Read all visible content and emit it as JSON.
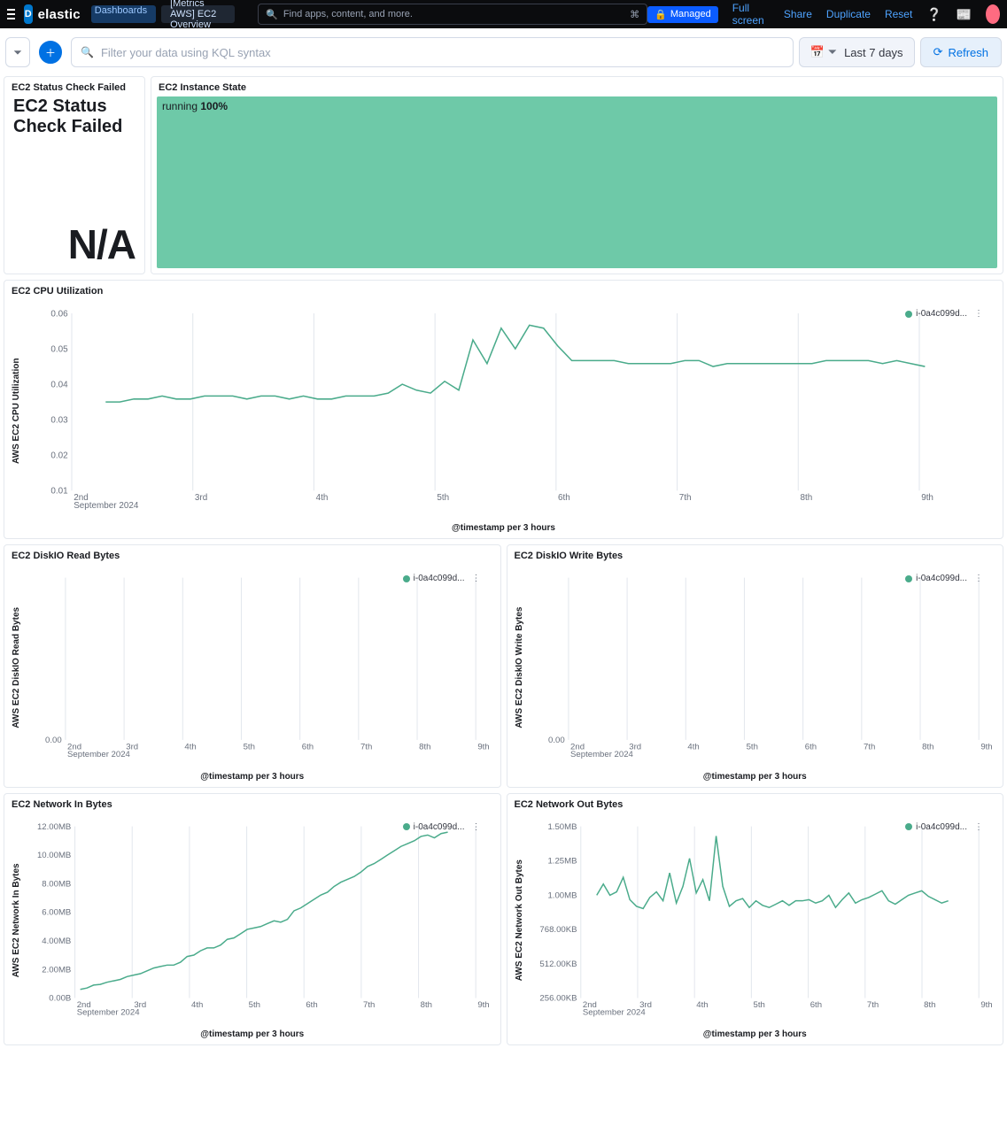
{
  "top": {
    "logo_text": "elastic",
    "logo_badge": "D",
    "breadcrumb_1": "Dashboards",
    "breadcrumb_2": "[Metrics AWS] EC2 Overview",
    "search_placeholder": "Find apps, content, and more.",
    "managed": "Managed",
    "links": [
      "Full screen",
      "Share",
      "Duplicate",
      "Reset"
    ]
  },
  "filter": {
    "placeholder": "Filter your data using KQL syntax",
    "time": "Last 7 days",
    "refresh": "Refresh"
  },
  "panels": {
    "status_fail": {
      "title": "EC2 Status Check Failed",
      "heading": "EC2 Status Check Failed",
      "value": "N/A"
    },
    "state": {
      "title": "EC2 Instance State",
      "label": "running",
      "pct": "100%"
    },
    "cpu": {
      "title": "EC2 CPU Utilization",
      "ylabel": "AWS EC2 CPU Utilization",
      "xlabel": "@timestamp per 3 hours"
    },
    "disk_r": {
      "title": "EC2 DiskIO Read Bytes",
      "ylabel": "AWS EC2 DiskIO Read Bytes",
      "xlabel": "@timestamp per 3 hours"
    },
    "disk_w": {
      "title": "EC2 DiskIO Write Bytes",
      "ylabel": "AWS EC2 DiskIO Write Bytes",
      "xlabel": "@timestamp per 3 hours"
    },
    "net_in": {
      "title": "EC2 Network In Bytes",
      "ylabel": "AWS EC2 Network In Bytes",
      "xlabel": "@timestamp per 3 hours"
    },
    "net_out": {
      "title": "EC2 Network Out Bytes",
      "ylabel": "AWS EC2 Network Out Bytes",
      "xlabel": "@timestamp per 3 hours"
    },
    "legend_series": "i-0a4c099d..."
  },
  "x_month": "September 2024",
  "chart_data": [
    {
      "id": "cpu",
      "type": "line",
      "title": "EC2 CPU Utilization",
      "xlabel": "@timestamp per 3 hours",
      "ylabel": "AWS EC2 CPU Utilization",
      "ylim": [
        0,
        0.06
      ],
      "yticks": [
        0.01,
        0.02,
        0.03,
        0.04,
        0.05,
        0.06
      ],
      "xticks": [
        "2nd",
        "3rd",
        "4th",
        "5th",
        "6th",
        "7th",
        "8th",
        "9th"
      ],
      "series": [
        {
          "name": "i-0a4c099d...",
          "x_start": 2.3,
          "x_step": 0.125,
          "values": [
            0.03,
            0.03,
            0.031,
            0.031,
            0.032,
            0.031,
            0.031,
            0.032,
            0.032,
            0.032,
            0.031,
            0.032,
            0.032,
            0.031,
            0.032,
            0.031,
            0.031,
            0.032,
            0.032,
            0.032,
            0.033,
            0.036,
            0.034,
            0.033,
            0.037,
            0.034,
            0.051,
            0.043,
            0.055,
            0.048,
            0.056,
            0.055,
            0.049,
            0.044,
            0.044,
            0.044,
            0.044,
            0.043,
            0.043,
            0.043,
            0.043,
            0.044,
            0.044,
            0.042,
            0.043,
            0.043,
            0.043,
            0.043,
            0.043,
            0.043,
            0.043,
            0.044,
            0.044,
            0.044,
            0.044,
            0.043,
            0.044,
            0.043,
            0.042
          ]
        }
      ]
    },
    {
      "id": "disk_r",
      "type": "line",
      "title": "EC2 DiskIO Read Bytes",
      "xlabel": "@timestamp per 3 hours",
      "ylabel": "AWS EC2 DiskIO Read Bytes",
      "yticks": [
        "0.00"
      ],
      "xticks": [
        "2nd",
        "3rd",
        "4th",
        "5th",
        "6th",
        "7th",
        "8th",
        "9th"
      ],
      "series": [
        {
          "name": "i-0a4c099d...",
          "values": []
        }
      ]
    },
    {
      "id": "disk_w",
      "type": "line",
      "title": "EC2 DiskIO Write Bytes",
      "xlabel": "@timestamp per 3 hours",
      "ylabel": "AWS EC2 DiskIO Write Bytes",
      "yticks": [
        "0.00"
      ],
      "xticks": [
        "2nd",
        "3rd",
        "4th",
        "5th",
        "6th",
        "7th",
        "8th",
        "9th"
      ],
      "series": [
        {
          "name": "i-0a4c099d...",
          "values": []
        }
      ]
    },
    {
      "id": "net_in",
      "type": "line",
      "title": "EC2 Network In Bytes",
      "xlabel": "@timestamp per 3 hours",
      "ylabel": "AWS EC2 Network In Bytes",
      "ylim_mb": [
        0,
        12
      ],
      "yticks": [
        "0.00B",
        "2.00MB",
        "4.00MB",
        "6.00MB",
        "8.00MB",
        "10.00MB",
        "12.00MB"
      ],
      "xticks": [
        "2nd",
        "3rd",
        "4th",
        "5th",
        "6th",
        "7th",
        "8th",
        "9th"
      ],
      "series": [
        {
          "name": "i-0a4c099d...",
          "x_start": 2.1,
          "x_step": 0.125,
          "values_mb": [
            0.6,
            0.7,
            0.9,
            0.95,
            1.1,
            1.2,
            1.3,
            1.5,
            1.6,
            1.7,
            1.9,
            2.1,
            2.2,
            2.3,
            2.3,
            2.5,
            2.9,
            3.0,
            3.3,
            3.5,
            3.5,
            3.7,
            4.1,
            4.2,
            4.5,
            4.8,
            4.9,
            5.0,
            5.2,
            5.4,
            5.3,
            5.5,
            6.1,
            6.3,
            6.6,
            6.9,
            7.2,
            7.4,
            7.8,
            8.1,
            8.3,
            8.5,
            8.8,
            9.2,
            9.4,
            9.7,
            10.0,
            10.3,
            10.6,
            10.8,
            11.0,
            11.3,
            11.4,
            11.2,
            11.5,
            11.6
          ]
        }
      ]
    },
    {
      "id": "net_out",
      "type": "line",
      "title": "EC2 Network Out Bytes",
      "xlabel": "@timestamp per 3 hours",
      "ylabel": "AWS EC2 Network Out Bytes",
      "ylim_kb": [
        0,
        1536
      ],
      "yticks": [
        "256.00KB",
        "512.00KB",
        "768.00KB",
        "1.00MB",
        "1.25MB",
        "1.50MB"
      ],
      "xticks": [
        "2nd",
        "3rd",
        "4th",
        "5th",
        "6th",
        "7th",
        "8th",
        "9th"
      ],
      "series": [
        {
          "name": "i-0a4c099d...",
          "x_start": 2.3,
          "x_step": 0.125,
          "values_kb": [
            920,
            1020,
            920,
            950,
            1080,
            880,
            820,
            800,
            900,
            950,
            870,
            1120,
            850,
            1000,
            1250,
            940,
            1060,
            870,
            1450,
            1000,
            820,
            870,
            890,
            810,
            870,
            830,
            810,
            840,
            870,
            830,
            870,
            870,
            880,
            850,
            870,
            920,
            810,
            880,
            940,
            850,
            880,
            900,
            930,
            960,
            870,
            840,
            880,
            920,
            940,
            960,
            910,
            880,
            850,
            870
          ]
        }
      ]
    }
  ]
}
